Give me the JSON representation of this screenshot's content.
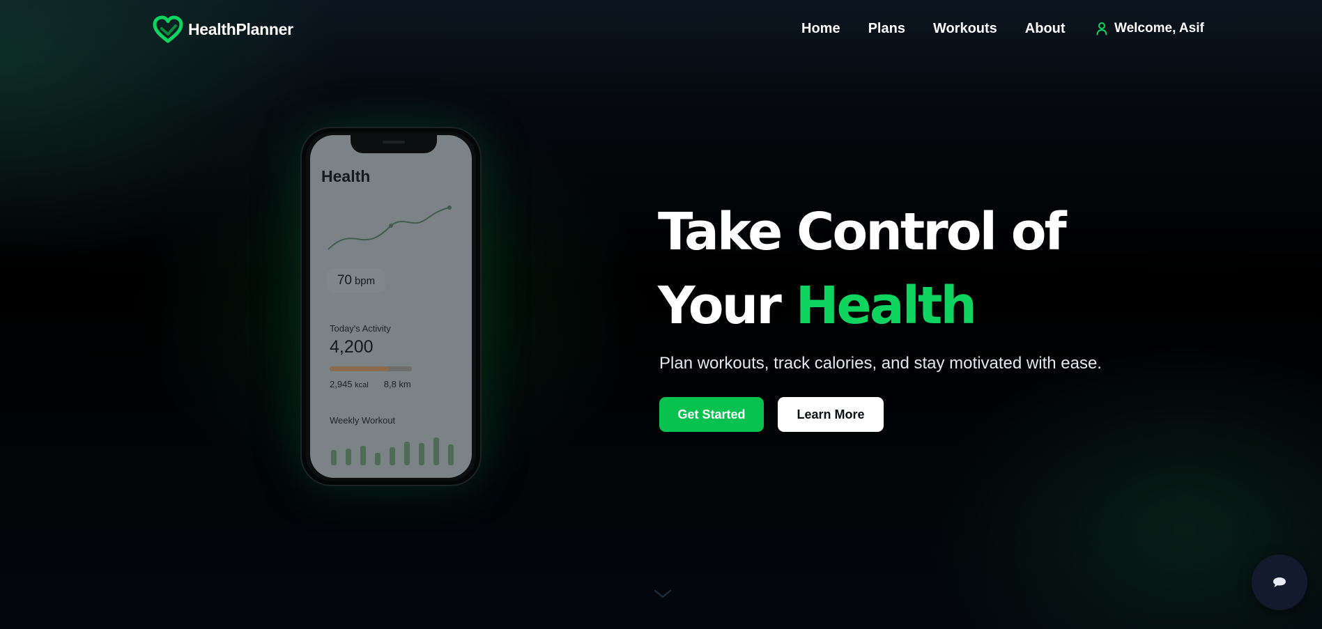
{
  "brand": {
    "name": "HealthPlanner",
    "logo_icon": "heart-logo-icon",
    "accent": "#10d460"
  },
  "nav": {
    "links": [
      {
        "label": "Home"
      },
      {
        "label": "Plans"
      },
      {
        "label": "Workouts"
      },
      {
        "label": "About"
      }
    ],
    "user": {
      "icon": "user-icon",
      "label": "Welcome, Asif"
    }
  },
  "phone": {
    "title": "Health",
    "heart_rate": {
      "value": "70",
      "unit": "bpm"
    },
    "activity": {
      "label": "Today's Activity",
      "value": "4,200",
      "progress": 0.72,
      "kcal_value": "2,945",
      "kcal_unit": "kcal",
      "distance": "8,8 km"
    },
    "weekly": {
      "label": "Weekly Workout",
      "bars": [
        0.55,
        0.6,
        0.7,
        0.45,
        0.65,
        0.85,
        0.8,
        1.0,
        0.75
      ]
    }
  },
  "hero": {
    "line1": "Take Control of",
    "line2_prefix": "Your",
    "line2_accent": "Health",
    "subtitle": "Plan workouts, track calories, and stay motivated with ease.",
    "primary_cta": "Get Started",
    "secondary_cta": "Learn More"
  },
  "widgets": {
    "scroll_icon": "chevron-down-icon",
    "chat_icon": "chat-bubble-icon"
  },
  "colors": {
    "primary_button": "#08c24f",
    "accent_text": "#10d460",
    "chat_fab": "#131a2e"
  }
}
